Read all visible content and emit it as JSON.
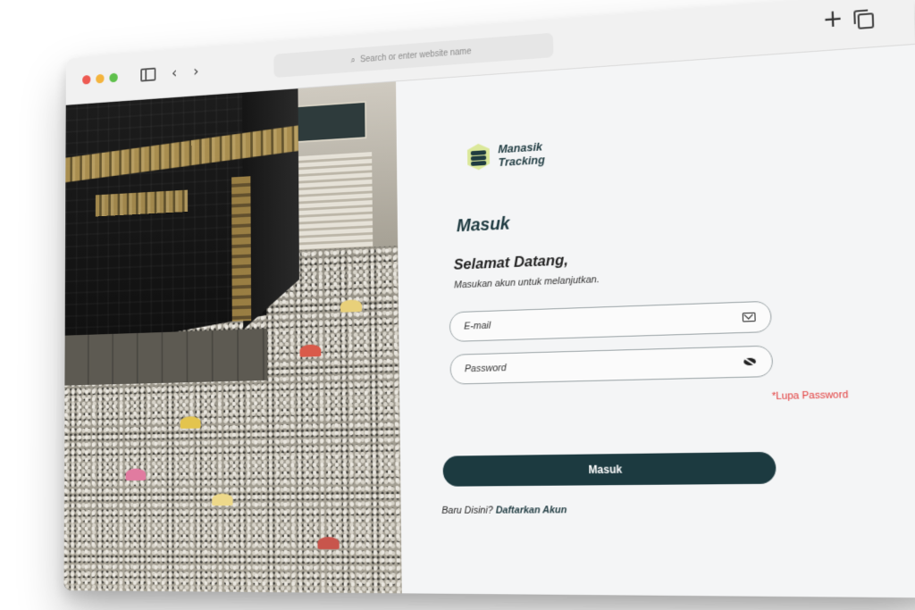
{
  "browser": {
    "address_placeholder": "Search or enter website name",
    "traffic_colors": [
      "#ee5a52",
      "#f4b43d",
      "#5fc04c"
    ],
    "icons": [
      "sidebar-icon",
      "chevron-left-icon",
      "chevron-right-icon",
      "search-icon",
      "plus-icon",
      "tabs-icon"
    ]
  },
  "logo": {
    "line1": "Manasik",
    "line2": "Tracking"
  },
  "login": {
    "title": "Masuk",
    "welcome": "Selamat Datang,",
    "subtitle": "Masukan akun untuk melanjutkan.",
    "email_label": "E-mail",
    "password_label": "Password",
    "forgot_label": "*Lupa Password",
    "submit_label": "Masuk",
    "signup_prompt": "Baru Disini?",
    "signup_link": "Daftarkan Akun"
  },
  "colors": {
    "primary": "#1c3a40",
    "accent": "#e23b3b",
    "logo_green": "#dbe89a"
  }
}
